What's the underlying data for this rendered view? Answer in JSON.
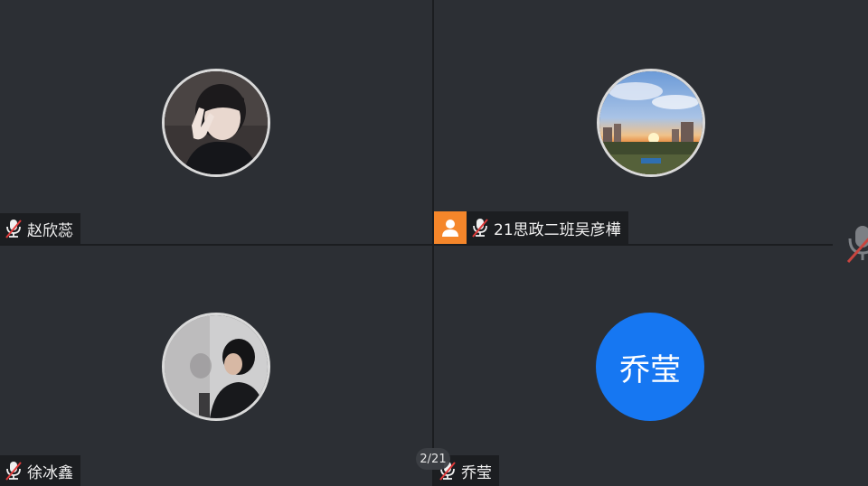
{
  "participants": [
    {
      "name": "赵欣蕊",
      "muted": true,
      "avatar": "photo-girl-peace-sign"
    },
    {
      "name": "21思政二班吴彦樺",
      "muted": true,
      "host": true,
      "avatar": "photo-sunset-city"
    },
    {
      "name": "徐冰鑫",
      "muted": true,
      "avatar": "photo-boy-dim-room"
    },
    {
      "name": "乔莹",
      "muted": true,
      "avatar_initials": "乔莹",
      "avatar_color": "#1677f2"
    }
  ],
  "pager": {
    "label": "2/21"
  },
  "colors": {
    "host_badge": "#f5862a",
    "muted_slash": "#e03a3a",
    "background": "#2c2f34"
  }
}
